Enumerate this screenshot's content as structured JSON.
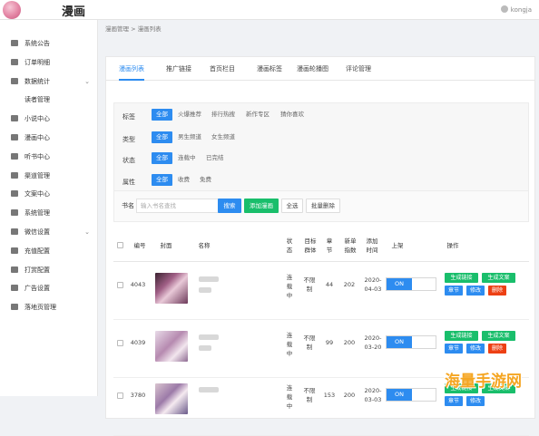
{
  "header": {
    "logo_text": "漫画",
    "user": "kongja"
  },
  "sidebar": {
    "items": [
      {
        "label": "系统公告",
        "icon": "megaphone-icon",
        "sub": false,
        "caret": false
      },
      {
        "label": "订单明细",
        "icon": "order-icon",
        "sub": false,
        "caret": false
      },
      {
        "label": "数据统计",
        "icon": "stats-icon",
        "sub": false,
        "caret": true
      },
      {
        "label": "读者管理",
        "icon": "",
        "sub": true,
        "caret": false
      },
      {
        "label": "小说中心",
        "icon": "book-icon",
        "sub": false,
        "caret": false
      },
      {
        "label": "漫画中心",
        "icon": "comic-icon",
        "sub": false,
        "caret": false
      },
      {
        "label": "听书中心",
        "icon": "audio-icon",
        "sub": false,
        "caret": false
      },
      {
        "label": "渠道管理",
        "icon": "channel-icon",
        "sub": false,
        "caret": false
      },
      {
        "label": "文案中心",
        "icon": "copy-icon",
        "sub": false,
        "caret": false
      },
      {
        "label": "系统管理",
        "icon": "settings-icon",
        "sub": false,
        "caret": false
      },
      {
        "label": "微信设置",
        "icon": "wechat-icon",
        "sub": false,
        "caret": true
      },
      {
        "label": "充值配置",
        "icon": "cloud-icon",
        "sub": false,
        "caret": false
      },
      {
        "label": "打赏配置",
        "icon": "gift-icon",
        "sub": false,
        "caret": false
      },
      {
        "label": "广告设置",
        "icon": "ad-icon",
        "sub": false,
        "caret": false
      },
      {
        "label": "落地页管理",
        "icon": "page-icon",
        "sub": false,
        "caret": false
      }
    ]
  },
  "breadcrumb": "漫画管理 > 漫画列表",
  "tabs": [
    "漫画列表",
    "推广链接",
    "首页栏目",
    "漫画标签",
    "漫画轮播图",
    "评论管理"
  ],
  "filters": {
    "tag": {
      "label": "标签",
      "options": [
        "全部",
        "火爆推荐",
        "排行热搜",
        "新作专区",
        "猜你喜欢"
      ]
    },
    "type": {
      "label": "类型",
      "options": [
        "全部",
        "男生频道",
        "女生频道"
      ]
    },
    "status": {
      "label": "状态",
      "options": [
        "全部",
        "连载中",
        "已完结"
      ]
    },
    "attr": {
      "label": "属性",
      "options": [
        "全部",
        "收费",
        "免费"
      ]
    }
  },
  "search": {
    "label": "书名",
    "placeholder": "输入书名查找",
    "search_btn": "搜索",
    "add_btn": "添加漫画",
    "select_all": "全选",
    "batch_delete": "批量删除"
  },
  "table": {
    "headers": {
      "id": "编号",
      "cover": "封面",
      "name": "名称",
      "status": "状态",
      "group": "目标群体",
      "chapters": "章节",
      "new_index": "新单指数",
      "added": "添加时间",
      "shelf": "上架",
      "ops": "操作"
    },
    "rows": [
      {
        "id": "4043",
        "status": "连载中",
        "group": "不限制",
        "chapters": "44",
        "index": "202",
        "date": "2020-04-03",
        "toggle": "ON"
      },
      {
        "id": "4039",
        "status": "连载中",
        "group": "不限制",
        "chapters": "99",
        "index": "200",
        "date": "2020-03-20",
        "toggle": "ON"
      },
      {
        "id": "3780",
        "status": "连载中",
        "group": "不限制",
        "chapters": "153",
        "index": "200",
        "date": "2020-03-03",
        "toggle": "ON"
      }
    ],
    "actions": {
      "link": "生成链接",
      "copy": "生成文案",
      "chapter": "章节",
      "edit": "修改",
      "delete": "删除"
    }
  },
  "watermark": "海量手游网"
}
